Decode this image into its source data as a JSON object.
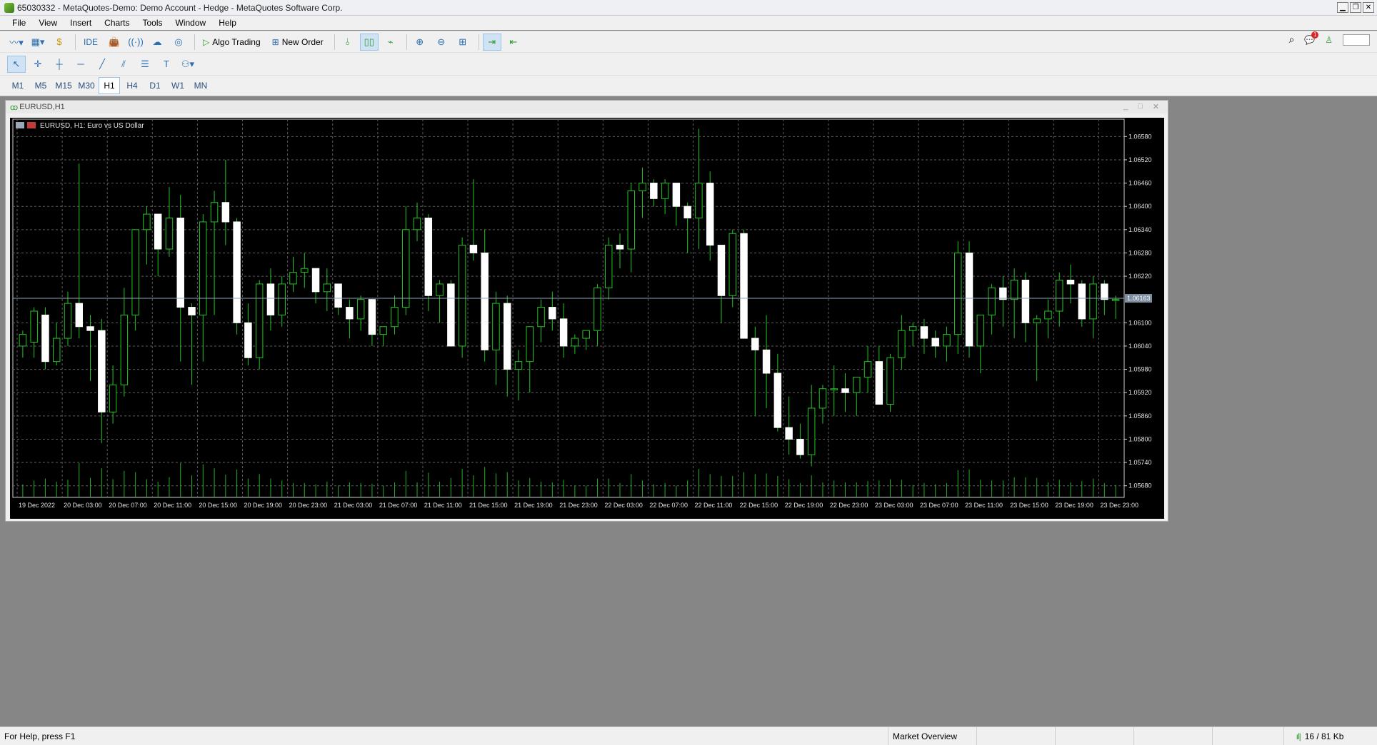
{
  "window": {
    "title": "65030332 - MetaQuotes-Demo: Demo Account - Hedge - MetaQuotes Software Corp."
  },
  "menu": [
    "File",
    "View",
    "Insert",
    "Charts",
    "Tools",
    "Window",
    "Help"
  ],
  "toolbar": {
    "ide_label": "IDE",
    "algo_trading_label": "Algo Trading",
    "new_order_label": "New Order",
    "notification_count": "1"
  },
  "timeframes": [
    "M1",
    "M5",
    "M15",
    "M30",
    "H1",
    "H4",
    "D1",
    "W1",
    "MN"
  ],
  "active_timeframe": "H1",
  "chart_window": {
    "title": "EURUSD,H1",
    "header": "EURUSD, H1:  Euro vs US Dollar"
  },
  "chart_data": {
    "type": "candlestick",
    "symbol": "EURUSD",
    "timeframe": "H1",
    "ylim": [
      1.0565,
      1.0661
    ],
    "y_ticks": [
      "1.06580",
      "1.06520",
      "1.06460",
      "1.06400",
      "1.06340",
      "1.06280",
      "1.06220",
      "1.06100",
      "1.06040",
      "1.05980",
      "1.05920",
      "1.05860",
      "1.05800",
      "1.05740",
      "1.05680"
    ],
    "current_price": "1.06163",
    "x_ticks": [
      "19 Dec 2022",
      "20 Dec 03:00",
      "20 Dec 07:00",
      "20 Dec 11:00",
      "20 Dec 15:00",
      "20 Dec 19:00",
      "20 Dec 23:00",
      "21 Dec 03:00",
      "21 Dec 07:00",
      "21 Dec 11:00",
      "21 Dec 15:00",
      "21 Dec 19:00",
      "21 Dec 23:00",
      "22 Dec 03:00",
      "22 Dec 07:00",
      "22 Dec 11:00",
      "22 Dec 15:00",
      "22 Dec 19:00",
      "22 Dec 23:00",
      "23 Dec 03:00",
      "23 Dec 07:00",
      "23 Dec 11:00",
      "23 Dec 15:00",
      "23 Dec 19:00",
      "23 Dec 23:00"
    ],
    "ohlc": [
      [
        1.0604,
        1.0608,
        1.0601,
        1.0607
      ],
      [
        1.0605,
        1.0614,
        1.0601,
        1.0613
      ],
      [
        1.0612,
        1.0614,
        1.0598,
        1.06
      ],
      [
        1.06,
        1.061,
        1.0599,
        1.0606
      ],
      [
        1.0606,
        1.0618,
        1.0604,
        1.0615
      ],
      [
        1.0615,
        1.0651,
        1.0606,
        1.0609
      ],
      [
        1.0609,
        1.0612,
        1.0595,
        1.0608
      ],
      [
        1.0608,
        1.0611,
        1.0579,
        1.0587
      ],
      [
        1.0587,
        1.0599,
        1.0584,
        1.0594
      ],
      [
        1.0594,
        1.0619,
        1.0591,
        1.0612
      ],
      [
        1.0612,
        1.0634,
        1.0608,
        1.0634
      ],
      [
        1.0634,
        1.064,
        1.0625,
        1.0638
      ],
      [
        1.0638,
        1.0633,
        1.0622,
        1.0629
      ],
      [
        1.0629,
        1.0645,
        1.0627,
        1.0637
      ],
      [
        1.0637,
        1.0643,
        1.06,
        1.0614
      ],
      [
        1.0614,
        1.0615,
        1.0594,
        1.0612
      ],
      [
        1.0612,
        1.0638,
        1.06,
        1.0636
      ],
      [
        1.0636,
        1.0644,
        1.0612,
        1.0641
      ],
      [
        1.0641,
        1.0652,
        1.063,
        1.0636
      ],
      [
        1.0636,
        1.0637,
        1.0607,
        1.061
      ],
      [
        1.061,
        1.0615,
        1.0599,
        1.0601
      ],
      [
        1.0601,
        1.0621,
        1.0598,
        1.062
      ],
      [
        1.062,
        1.0624,
        1.0608,
        1.0612
      ],
      [
        1.0612,
        1.0622,
        1.0609,
        1.062
      ],
      [
        1.062,
        1.0627,
        1.0618,
        1.0623
      ],
      [
        1.0623,
        1.0628,
        1.0619,
        1.0624
      ],
      [
        1.0624,
        1.0622,
        1.0615,
        1.0618
      ],
      [
        1.0618,
        1.0624,
        1.0613,
        1.062
      ],
      [
        1.062,
        1.0617,
        1.0612,
        1.0614
      ],
      [
        1.0614,
        1.0616,
        1.0606,
        1.0611
      ],
      [
        1.0611,
        1.0617,
        1.0608,
        1.0616
      ],
      [
        1.0616,
        1.0612,
        1.0604,
        1.0607
      ],
      [
        1.0607,
        1.0609,
        1.0604,
        1.0609
      ],
      [
        1.0609,
        1.0617,
        1.0607,
        1.0614
      ],
      [
        1.0614,
        1.064,
        1.0612,
        1.0634
      ],
      [
        1.0634,
        1.0641,
        1.0631,
        1.0637
      ],
      [
        1.0637,
        1.0638,
        1.0613,
        1.0617
      ],
      [
        1.0617,
        1.0621,
        1.061,
        1.062
      ],
      [
        1.062,
        1.0621,
        1.0604,
        1.0604
      ],
      [
        1.0604,
        1.0632,
        1.0601,
        1.063
      ],
      [
        1.063,
        1.0647,
        1.0626,
        1.0628
      ],
      [
        1.0628,
        1.0634,
        1.06,
        1.0603
      ],
      [
        1.0603,
        1.0618,
        1.0594,
        1.0615
      ],
      [
        1.0615,
        1.0617,
        1.0591,
        1.0598
      ],
      [
        1.0598,
        1.0603,
        1.059,
        1.06
      ],
      [
        1.06,
        1.0609,
        1.0592,
        1.0609
      ],
      [
        1.0609,
        1.0616,
        1.0605,
        1.0614
      ],
      [
        1.0614,
        1.0618,
        1.0608,
        1.0611
      ],
      [
        1.0611,
        1.0615,
        1.0601,
        1.0604
      ],
      [
        1.0604,
        1.0607,
        1.0602,
        1.0606
      ],
      [
        1.0606,
        1.0608,
        1.0603,
        1.0608
      ],
      [
        1.0608,
        1.062,
        1.0604,
        1.0619
      ],
      [
        1.0619,
        1.0632,
        1.0616,
        1.063
      ],
      [
        1.063,
        1.0633,
        1.0624,
        1.0629
      ],
      [
        1.0629,
        1.0646,
        1.0623,
        1.0644
      ],
      [
        1.0644,
        1.065,
        1.0637,
        1.0646
      ],
      [
        1.0646,
        1.0647,
        1.064,
        1.0642
      ],
      [
        1.0642,
        1.0647,
        1.0638,
        1.0646
      ],
      [
        1.0646,
        1.064,
        1.0635,
        1.064
      ],
      [
        1.064,
        1.0641,
        1.0628,
        1.0637
      ],
      [
        1.0637,
        1.066,
        1.0629,
        1.0646
      ],
      [
        1.0646,
        1.0649,
        1.0626,
        1.063
      ],
      [
        1.063,
        1.063,
        1.061,
        1.0617
      ],
      [
        1.0617,
        1.0634,
        1.0614,
        1.0633
      ],
      [
        1.0633,
        1.0634,
        1.0608,
        1.0606
      ],
      [
        1.0606,
        1.0609,
        1.0586,
        1.0603
      ],
      [
        1.0603,
        1.0612,
        1.0588,
        1.0597
      ],
      [
        1.0597,
        1.0602,
        1.0582,
        1.0583
      ],
      [
        1.0583,
        1.0591,
        1.0576,
        1.058
      ],
      [
        1.058,
        1.0584,
        1.0575,
        1.0576
      ],
      [
        1.0576,
        1.0594,
        1.0573,
        1.0588
      ],
      [
        1.0588,
        1.0594,
        1.0584,
        1.0593
      ],
      [
        1.0593,
        1.0599,
        1.0586,
        1.0593
      ],
      [
        1.0593,
        1.0597,
        1.0587,
        1.0592
      ],
      [
        1.0592,
        1.0596,
        1.0586,
        1.0596
      ],
      [
        1.0596,
        1.0604,
        1.0592,
        1.06
      ],
      [
        1.06,
        1.0604,
        1.0591,
        1.0589
      ],
      [
        1.0589,
        1.0602,
        1.0587,
        1.0601
      ],
      [
        1.0601,
        1.0612,
        1.0598,
        1.0608
      ],
      [
        1.0608,
        1.061,
        1.0604,
        1.0609
      ],
      [
        1.0609,
        1.0611,
        1.0602,
        1.0606
      ],
      [
        1.0606,
        1.0608,
        1.0601,
        1.0604
      ],
      [
        1.0604,
        1.0609,
        1.06,
        1.0607
      ],
      [
        1.0607,
        1.0631,
        1.0602,
        1.0628
      ],
      [
        1.0628,
        1.0631,
        1.0601,
        1.0604
      ],
      [
        1.0604,
        1.0611,
        1.0597,
        1.0612
      ],
      [
        1.0612,
        1.062,
        1.0607,
        1.0619
      ],
      [
        1.0619,
        1.0622,
        1.0609,
        1.0616
      ],
      [
        1.0616,
        1.0624,
        1.0606,
        1.0621
      ],
      [
        1.0621,
        1.0623,
        1.0605,
        1.061
      ],
      [
        1.061,
        1.0612,
        1.0595,
        1.0611
      ],
      [
        1.0611,
        1.0616,
        1.0606,
        1.0613
      ],
      [
        1.0613,
        1.0623,
        1.0609,
        1.0621
      ],
      [
        1.0621,
        1.0625,
        1.0615,
        1.062
      ],
      [
        1.062,
        1.0621,
        1.0609,
        1.0611
      ],
      [
        1.0611,
        1.0622,
        1.0606,
        1.062
      ],
      [
        1.062,
        1.0621,
        1.0612,
        1.0616
      ],
      [
        1.0616,
        1.0617,
        1.0611,
        1.0616
      ]
    ]
  },
  "status": {
    "help": "For Help, press F1",
    "market": "Market Overview",
    "connection": "16 / 81 Kb"
  }
}
